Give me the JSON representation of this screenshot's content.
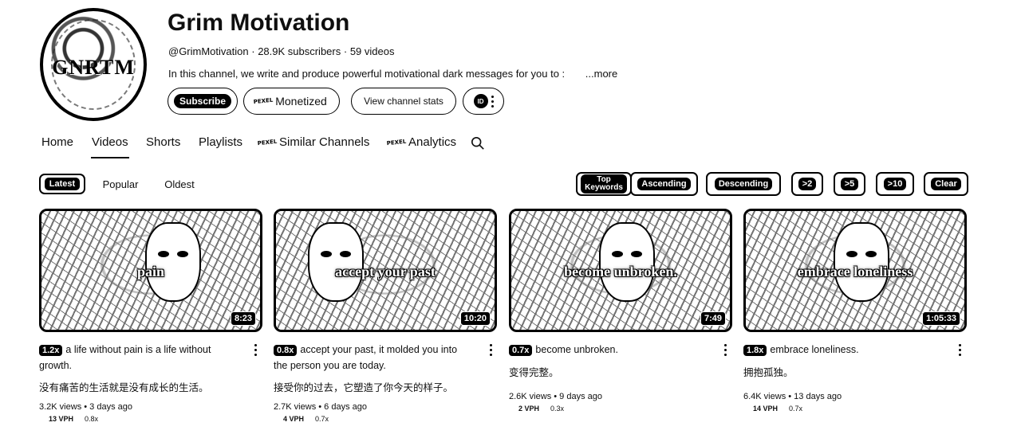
{
  "channel": {
    "avatar_text": "GNRTM",
    "name": "Grim Motivation",
    "handle": "@GrimMotivation",
    "subscribers": "28.9K subscribers",
    "videos": "59 videos",
    "description": "In this channel, we write and produce powerful motivational dark messages for you to :",
    "more_label": "...more",
    "subscribe_label": "Subscribe",
    "monetized_label": "Monetized",
    "stats_label": "View channel stats",
    "ext_label": "ID"
  },
  "badge_text": "PEXEL",
  "tabs": [
    {
      "label": "Home"
    },
    {
      "label": "Videos"
    },
    {
      "label": "Shorts"
    },
    {
      "label": "Playlists"
    },
    {
      "label": "Similar Channels"
    },
    {
      "label": "Analytics"
    }
  ],
  "filters": {
    "sort": [
      "Latest",
      "Popular",
      "Oldest"
    ],
    "buttons": [
      "Top Keywords",
      "Ascending",
      "Descending",
      ">2",
      ">5",
      ">10",
      "Clear"
    ]
  },
  "videos": [
    {
      "thumb_text": "pain",
      "duration": "8:23",
      "ratio": "1.2x",
      "title": "a life without pain is a life without growth.",
      "title_zh": "没有痛苦的生活就是没有成长的生活。",
      "views": "3.2K views",
      "age": "3 days ago",
      "vph": "13 VPH",
      "ratio2": "0.8x"
    },
    {
      "thumb_text": "accept your past",
      "duration": "10:20",
      "ratio": "0.8x",
      "title": "accept your past, it molded you into the person you are today.",
      "title_zh": "接受你的过去，它塑造了你今天的样子。",
      "views": "2.7K views",
      "age": "6 days ago",
      "vph": "4 VPH",
      "ratio2": "0.7x"
    },
    {
      "thumb_text": "become unbroken.",
      "duration": "7:49",
      "ratio": "0.7x",
      "title": "become unbroken.",
      "title_zh": "变得完整。",
      "views": "2.6K views",
      "age": "9 days ago",
      "vph": "2 VPH",
      "ratio2": "0.3x"
    },
    {
      "thumb_text": "embrace loneliness",
      "duration": "1:05:33",
      "ratio": "1.8x",
      "title": "embrace loneliness.",
      "title_zh": "拥抱孤独。",
      "views": "6.4K views",
      "age": "13 days ago",
      "vph": "14 VPH",
      "ratio2": "0.7x"
    }
  ],
  "icons": [
    "search-icon",
    "more-vert-icon",
    "extension-icon",
    "pexel-badge-icon"
  ]
}
